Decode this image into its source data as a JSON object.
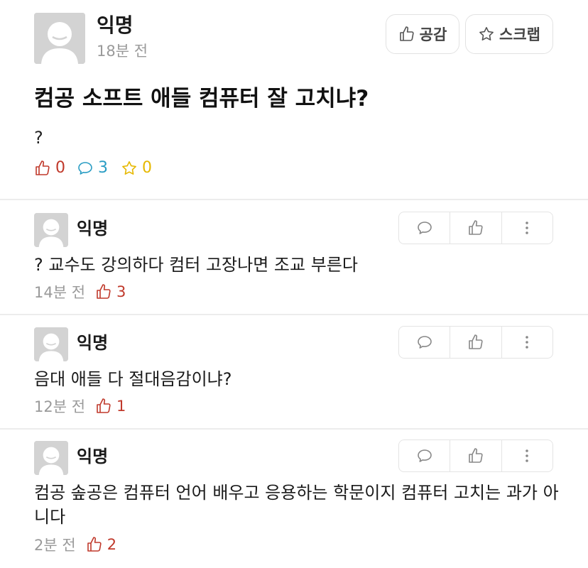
{
  "post": {
    "author": "익명",
    "time": "18분 전",
    "title": "컴공 소프트 애들 컴퓨터 잘 고치냐?",
    "body": "?",
    "empathy_button": "공감",
    "scrap_button": "스크랩",
    "like_count": "0",
    "comment_count": "3",
    "scrap_count": "0"
  },
  "comments": [
    {
      "author": "익명",
      "text": "? 교수도 강의하다 컴터 고장나면 조교 부른다",
      "time": "14분 전",
      "likes": "3"
    },
    {
      "author": "익명",
      "text": "음대 애들 다 절대음감이냐?",
      "time": "12분 전",
      "likes": "1"
    },
    {
      "author": "익명",
      "text": "컴공 솦공은 컴퓨터 언어 배우고 응용하는 학문이지 컴퓨터 고치는 과가 아니다",
      "time": "2분 전",
      "likes": "2"
    }
  ],
  "colors": {
    "like": "#c0392b",
    "comment": "#2a9dc4",
    "scrap": "#e6b800",
    "divider": "#ececec"
  },
  "icons": {
    "like": "thumbs-up-icon",
    "comment": "speech-bubble-icon",
    "scrap": "star-icon",
    "more": "vertical-dots-icon"
  }
}
